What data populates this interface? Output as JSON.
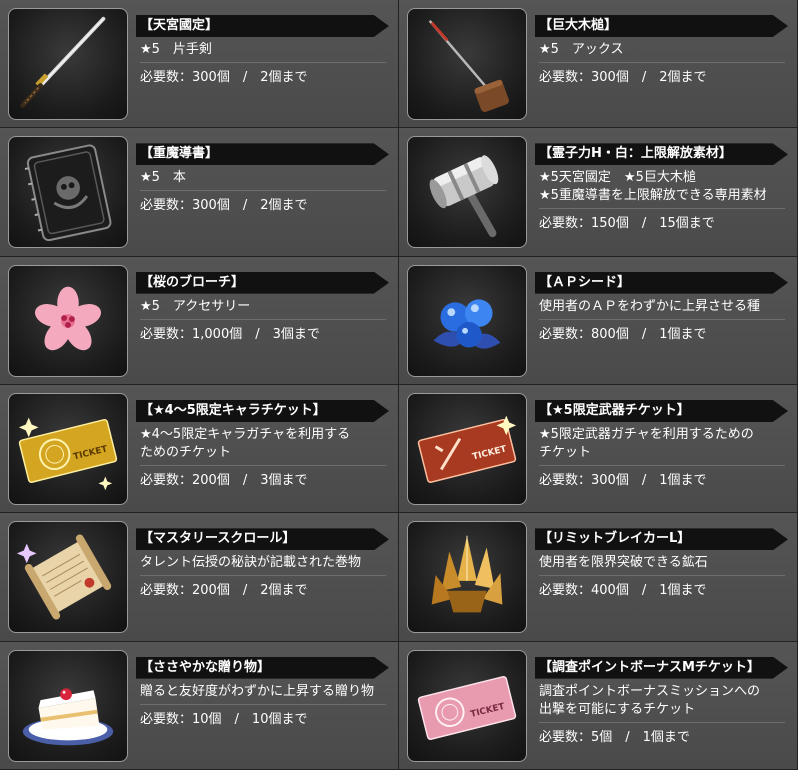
{
  "items": [
    {
      "name": "【天宮國定】",
      "desc": "★5　片手剣",
      "req": "必要数：300個　/　2個まで",
      "icon": "katana-icon"
    },
    {
      "name": "【巨大木槌】",
      "desc": "★5　アックス",
      "req": "必要数：300個　/　2個まで",
      "icon": "wooden-mallet-icon"
    },
    {
      "name": "【重魔導書】",
      "desc": "★5　本",
      "req": "必要数：300個　/　2個まで",
      "icon": "grimoire-icon"
    },
    {
      "name": "【霊子力H・白：上限解放素材】",
      "desc": "★5天宮國定　★5巨大木槌\n★5重魔導書を上限解放できる専用素材",
      "req": "必要数：150個　/　15個まで",
      "icon": "steel-hammer-icon"
    },
    {
      "name": "【桜のブローチ】",
      "desc": "★5　アクセサリー",
      "req": "必要数：1,000個　/　3個まで",
      "icon": "sakura-brooch-icon"
    },
    {
      "name": "【ＡＰシード】",
      "desc": "使用者のＡＰをわずかに上昇させる種",
      "req": "必要数：800個　/　1個まで",
      "icon": "blue-seed-icon"
    },
    {
      "name": "【★4～5限定キャラチケット】",
      "desc": "★4～5限定キャラガチャを利用する\nためのチケット",
      "req": "必要数：200個　/　3個まで",
      "icon": "gold-ticket-icon"
    },
    {
      "name": "【★5限定武器チケット】",
      "desc": "★5限定武器ガチャを利用するための\nチケット",
      "req": "必要数：300個　/　1個まで",
      "icon": "red-ticket-icon"
    },
    {
      "name": "【マスタリースクロール】",
      "desc": "タレント伝授の秘訣が記載された巻物",
      "req": "必要数：200個　/　2個まで",
      "icon": "scroll-icon"
    },
    {
      "name": "【リミットブレイカーL】",
      "desc": "使用者を限界突破できる鉱石",
      "req": "必要数：400個　/　1個まで",
      "icon": "crystal-ore-icon"
    },
    {
      "name": "【ささやかな贈り物】",
      "desc": "贈ると友好度がわずかに上昇する贈り物",
      "req": "必要数：10個　/　10個まで",
      "icon": "cake-icon"
    },
    {
      "name": "【調査ポイントボーナスMチケット】",
      "desc": "調査ポイントボーナスミッションへの\n出撃を可能にするチケット",
      "req": "必要数：5個　/　1個まで",
      "icon": "pink-ticket-icon"
    }
  ],
  "ticket_label": "TICKET"
}
